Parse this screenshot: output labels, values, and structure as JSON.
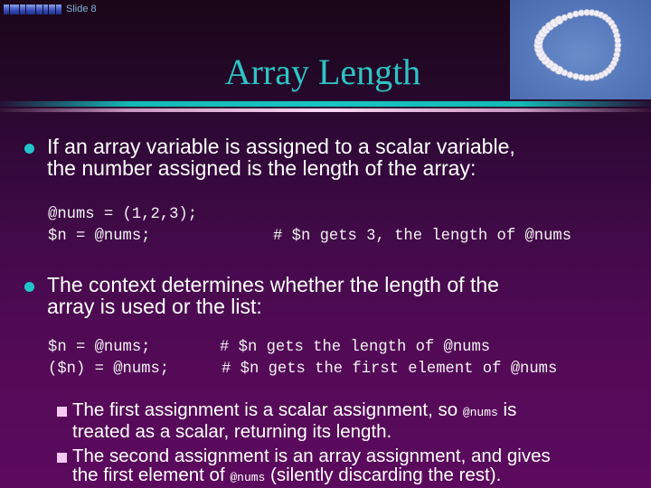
{
  "header": {
    "logo_label": "logo",
    "slide_number": "Slide 8"
  },
  "title": "Array Length",
  "bullets": [
    {
      "text": "If an array variable is assigned to a scalar variable, the number assigned is the length of the array:",
      "line1": "If an array variable is assigned to a scalar variable,",
      "line2": "the number assigned is the length of the array:",
      "code": [
        {
          "stmt": "@nums = (1,2,3);",
          "comment": ""
        },
        {
          "stmt": "$n = @nums;",
          "comment": "# $n gets 3, the length of @nums"
        }
      ]
    },
    {
      "text": "The context determines whether the length of the array is used or the list:",
      "line1": "The context determines whether the length of the",
      "line2": "array is used or the list:",
      "code": [
        {
          "stmt": "$n = @nums;",
          "comment": "# $n gets the length of @nums"
        },
        {
          "stmt": "($n) = @nums;",
          "comment": "# $n gets the first element of @nums"
        }
      ],
      "sub_bullets": [
        {
          "line1_before": "The first assignment is a scalar assignment, so ",
          "line1_code": "@nums",
          "line1_after": " is",
          "line2": "treated as a scalar, returning its length."
        },
        {
          "line1": "The second assignment is an array assignment, and gives",
          "line2_before": "the first element of ",
          "line2_code": "@nums",
          "line2_after": " (silently discarding the rest)."
        }
      ]
    }
  ],
  "colors": {
    "title": "#2ec4c4",
    "bullet_dot": "#22c4cc",
    "sub_bullet_square": "#f8c8f4",
    "rule_teal": "#18c4c4",
    "rule_pink": "#fbd8f4",
    "background_top": "#1a0618",
    "background_bottom": "#5c0a5e"
  }
}
